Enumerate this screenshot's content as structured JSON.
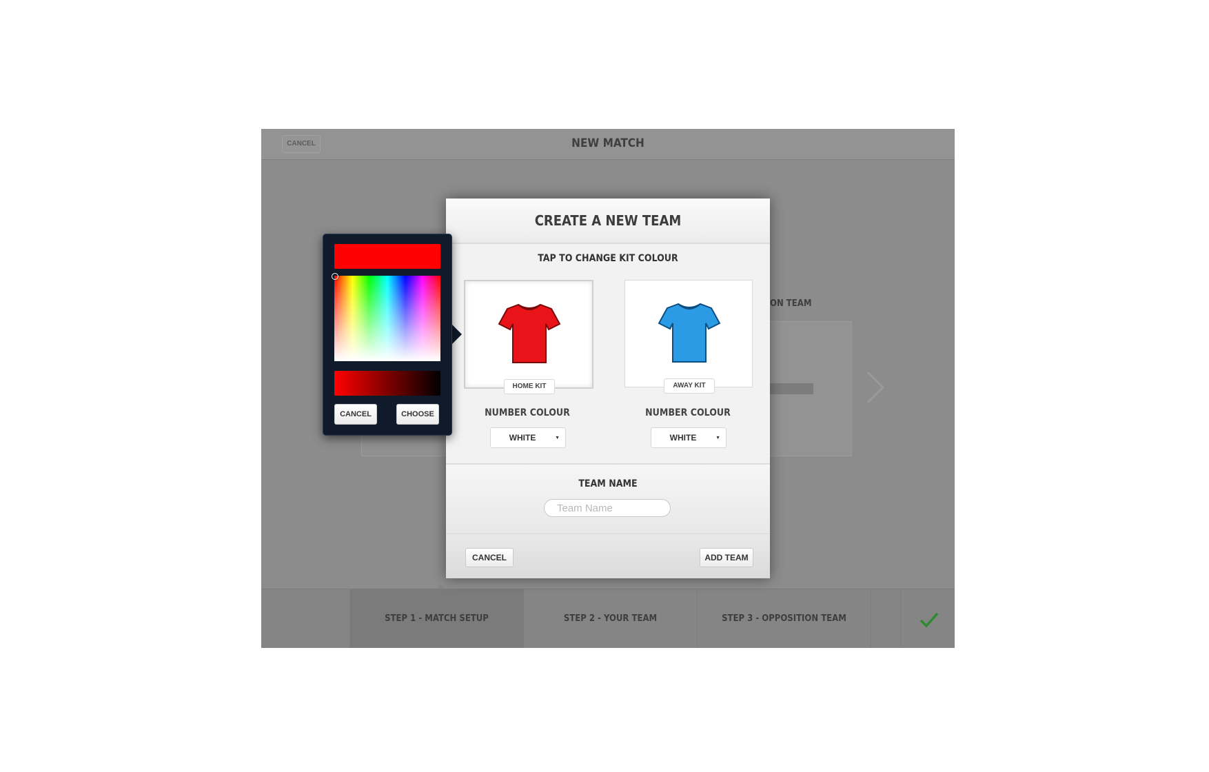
{
  "app": {
    "top_cancel_label": "CANCEL",
    "title": "NEW MATCH"
  },
  "background": {
    "opposition_label_partial": "ON TEAM"
  },
  "steps": [
    {
      "label": "STEP 1 - MATCH SETUP",
      "active": true
    },
    {
      "label": "STEP 2 - YOUR TEAM",
      "active": false
    },
    {
      "label": "STEP 3 - OPPOSITION TEAM",
      "active": false
    }
  ],
  "confirm_icon": "checkmark-icon",
  "modal": {
    "title": "CREATE A NEW TEAM",
    "kit_heading": "TAP TO CHANGE KIT COLOUR",
    "home_kit": {
      "label": "HOME KIT",
      "color": "#e8141a",
      "number_colour_label": "NUMBER COLOUR",
      "number_colour_value": "WHITE"
    },
    "away_kit": {
      "label": "AWAY KIT",
      "color": "#2c9be6",
      "number_colour_label": "NUMBER COLOUR",
      "number_colour_value": "WHITE"
    },
    "team_name_label": "TEAM NAME",
    "team_name_placeholder": "Team Name",
    "team_name_value": "",
    "cancel_label": "CANCEL",
    "add_label": "ADD TEAM"
  },
  "picker": {
    "selected_color": "#ff0000",
    "cancel_label": "CANCEL",
    "choose_label": "CHOOSE"
  }
}
